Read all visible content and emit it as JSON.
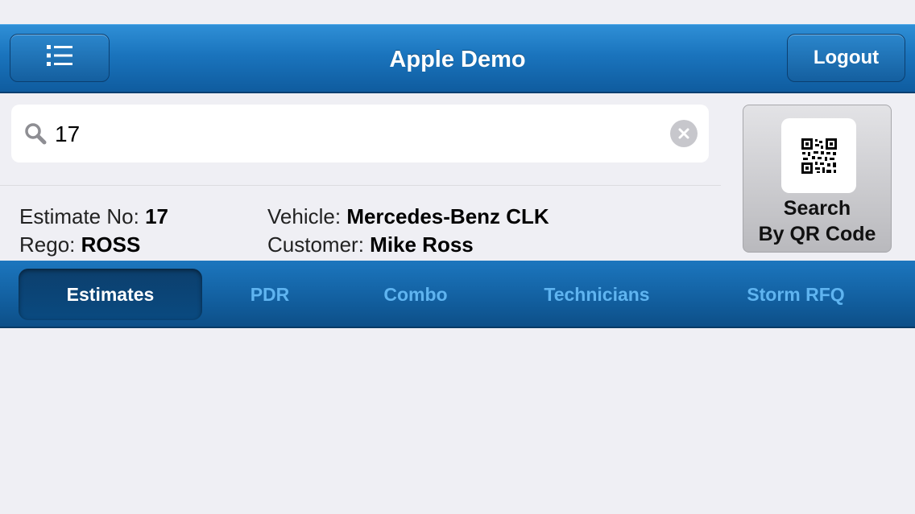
{
  "navbar": {
    "title": "Apple Demo",
    "menu_icon": "list-icon",
    "logout_label": "Logout"
  },
  "search": {
    "value": "17",
    "icon": "search-icon",
    "clear_icon": "clear-icon"
  },
  "estimate": {
    "estimate_no_label": "Estimate No:",
    "estimate_no": "17",
    "rego_label": "Rego:",
    "rego": "ROSS",
    "vehicle_label": "Vehicle:",
    "vehicle": "Mercedes-Benz CLK",
    "customer_label": "Customer:",
    "customer": "Mike Ross"
  },
  "qr_button": {
    "line1": "Search",
    "line2": "By QR Code",
    "icon": "qr-code-icon"
  },
  "tabs": [
    {
      "label": "Estimates",
      "active": true
    },
    {
      "label": "PDR",
      "active": false
    },
    {
      "label": "Combo",
      "active": false
    },
    {
      "label": "Technicians",
      "active": false
    },
    {
      "label": "Storm RFQ",
      "active": false
    }
  ],
  "colors": {
    "nav_blue": "#1a74bd",
    "tab_inactive": "#5fb4f0",
    "background": "#efeff4"
  }
}
